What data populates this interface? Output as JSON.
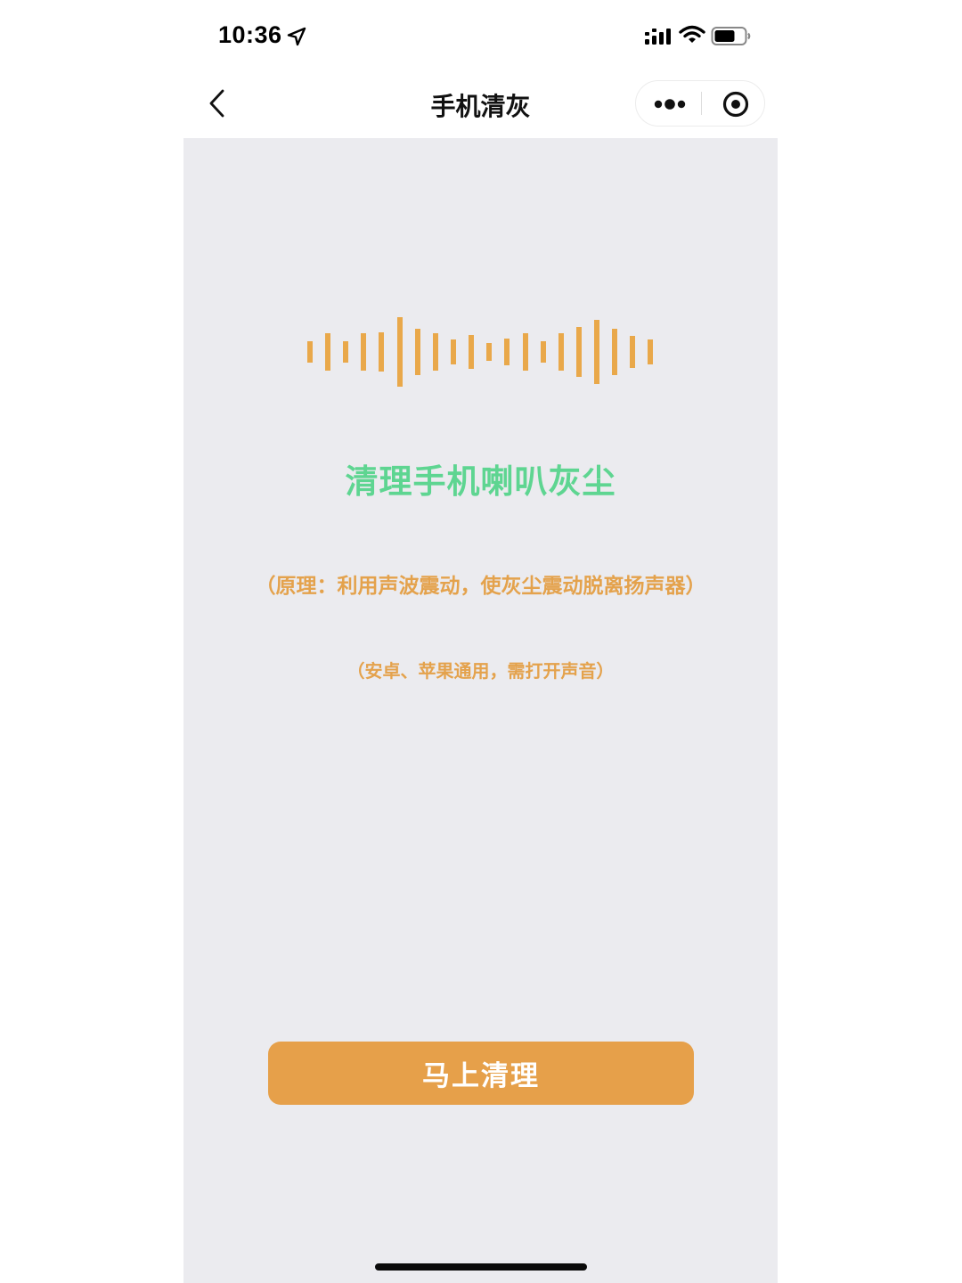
{
  "status_bar": {
    "time": "10:36",
    "icons": [
      "location-arrow-icon",
      "cellular-signal-icon",
      "wifi-icon",
      "battery-icon"
    ]
  },
  "nav": {
    "title": "手机清灰",
    "back_icon": "chevron-left-icon",
    "capsule_icons": [
      "more-dots-icon",
      "close-target-icon"
    ]
  },
  "main": {
    "headline": "清理手机喇叭灰尘",
    "principle": "（原理：利用声波震动，使灰尘震动脱离扬声器）",
    "compatibility": "（安卓、苹果通用，需打开声音）",
    "action_button": "马上清理",
    "waveform_color": "#e9a84a"
  },
  "colors": {
    "headline": "#5ed591",
    "accent_orange": "#e6a04a",
    "content_background": "#ebebef"
  }
}
